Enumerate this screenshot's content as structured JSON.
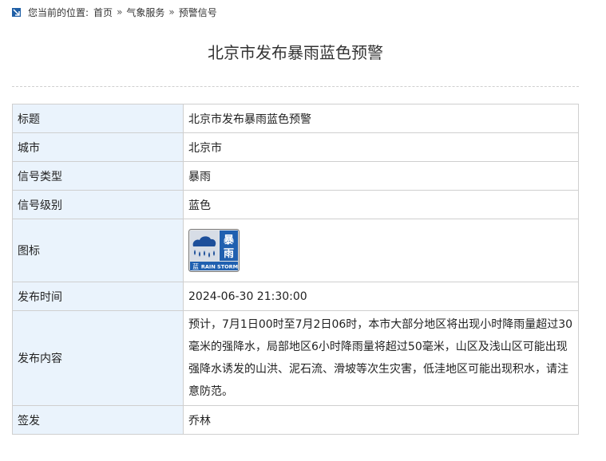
{
  "breadcrumb": {
    "prefix": "您当前的位置:",
    "items": [
      "首页",
      "气象服务",
      "预警信号"
    ],
    "separator": "»"
  },
  "page_title": "北京市发布暴雨蓝色预警",
  "table": {
    "rows": [
      {
        "label": "标题",
        "value": "北京市发布暴雨蓝色预警"
      },
      {
        "label": "城市",
        "value": "北京市"
      },
      {
        "label": "信号类型",
        "value": "暴雨"
      },
      {
        "label": "信号级别",
        "value": "蓝色"
      },
      {
        "label": "图标"
      },
      {
        "label": "发布时间",
        "value": "2024-06-30 21:30:00"
      },
      {
        "label": "发布内容",
        "value": "预计，7月1日00时至7月2日06时，本市大部分地区将出现小时降雨量超过30毫米的强降水，局部地区6小时降雨量将超过50毫米，山区及浅山区可能出现强降水诱发的山洪、泥石流、滑坡等次生灾害，低洼地区可能出现积水，请注意防范。"
      },
      {
        "label": "签发",
        "value": "乔林"
      }
    ]
  },
  "warning_icon": {
    "name": "rainstorm-blue-warning-icon",
    "title_chars": [
      "暴",
      "雨"
    ],
    "level_char": "蓝",
    "english": "RAIN STORM",
    "colors": {
      "blue": "#2060b0",
      "border": "#7a7a7a",
      "cloud": "#1d4f9a"
    }
  },
  "colors": {
    "label_bg": "#eaf3fc",
    "border": "#cfcfcf",
    "breadcrumb_icon": "#1f5fa6"
  }
}
